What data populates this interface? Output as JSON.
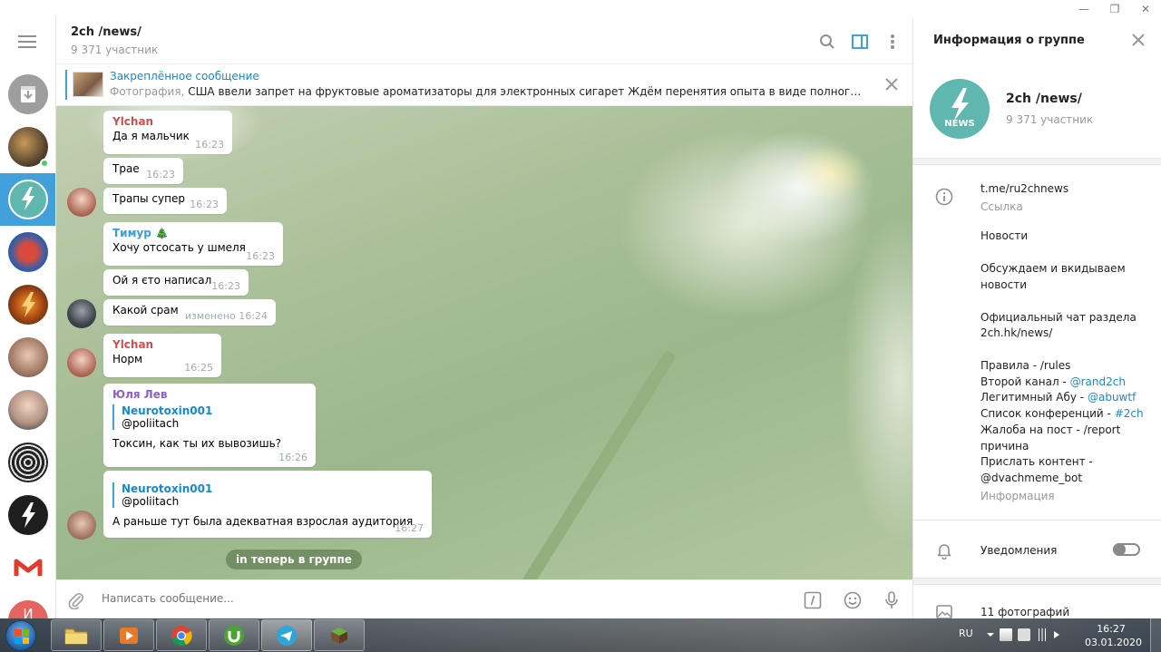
{
  "window": {
    "minimize": "—",
    "restore": "❐",
    "close": "✕"
  },
  "header": {
    "title": "2ch /news/",
    "subtitle": "9 371 участник"
  },
  "pinned": {
    "title": "Закреплённое сообщение",
    "kind": "Фотография,",
    "text": "США ввели запрет на фруктовые ароматизаторы для электронных сигарет  Ждём перенятия опыта в виде полного запрета вей..."
  },
  "messages": [
    {
      "author": "Ylchan",
      "author_color": "#d14e4e",
      "text": "Да я мальчик",
      "time": "16:23"
    },
    {
      "text": "Трае",
      "time": "16:23"
    },
    {
      "text": "Трапы супер",
      "time": "16:23"
    },
    {
      "author": "Тимур 🎄",
      "author_color": "#3a9edb",
      "text": "Хочу отсосать у шмеля",
      "time": "16:23"
    },
    {
      "text": "Ой я єто написал",
      "time": "16:23"
    },
    {
      "text": "Какой срам",
      "time": "изменено 16:24"
    },
    {
      "author": "Ylchan",
      "author_color": "#d14e4e",
      "text": "Норм",
      "time": "16:25"
    },
    {
      "author": "Юля Лев",
      "author_color": "#8e5fc7",
      "reply_name": "Neurotoxin001",
      "reply_text": "@poliitach",
      "text": "Токсин, как ты их вывозишь?",
      "time": "16:26"
    },
    {
      "reply_name": "Neurotoxin001",
      "reply_text": "@poliitach",
      "text": "А раньше тут была адекватная взрослая аудитория",
      "time": "16:27"
    }
  ],
  "service_message": "in теперь в группе",
  "compose": {
    "placeholder": "Написать сообщение..."
  },
  "info": {
    "title": "Информация о группе",
    "name": "2ch /news/",
    "subtitle": "9 371 участник",
    "avatar_label": "NEWS",
    "link": "t.me/ru2chnews",
    "link_label": "Ссылка",
    "desc": {
      "l1": "Новости",
      "l2": "Обсуждаем и вкидываем",
      "l3": "новости",
      "l4": "Официальный чат раздела",
      "l5": "2ch.hk/news/",
      "l6": "Правила - /rules",
      "l7a": "Второй канал - ",
      "l7b": "@rand2ch",
      "l8a": "Легитимный Абу - ",
      "l8b": "@abuwtf",
      "l9a": "Список конференций - ",
      "l9b": "#2ch",
      "l10": "Жалоба на пост - /report",
      "l11": "причина",
      "l12": "Прислать контент -",
      "l13": "@dvachmeme_bot"
    },
    "desc_label": "Информация",
    "notifications": "Уведомления",
    "photos": "11 фотографий"
  },
  "rail": {
    "last_avatar_letter": "И"
  },
  "taskbar": {
    "lang": "RU",
    "time": "16:27",
    "date": "03.01.2020"
  },
  "colors": {
    "accent": "#419fd9",
    "link": "#168acd"
  }
}
